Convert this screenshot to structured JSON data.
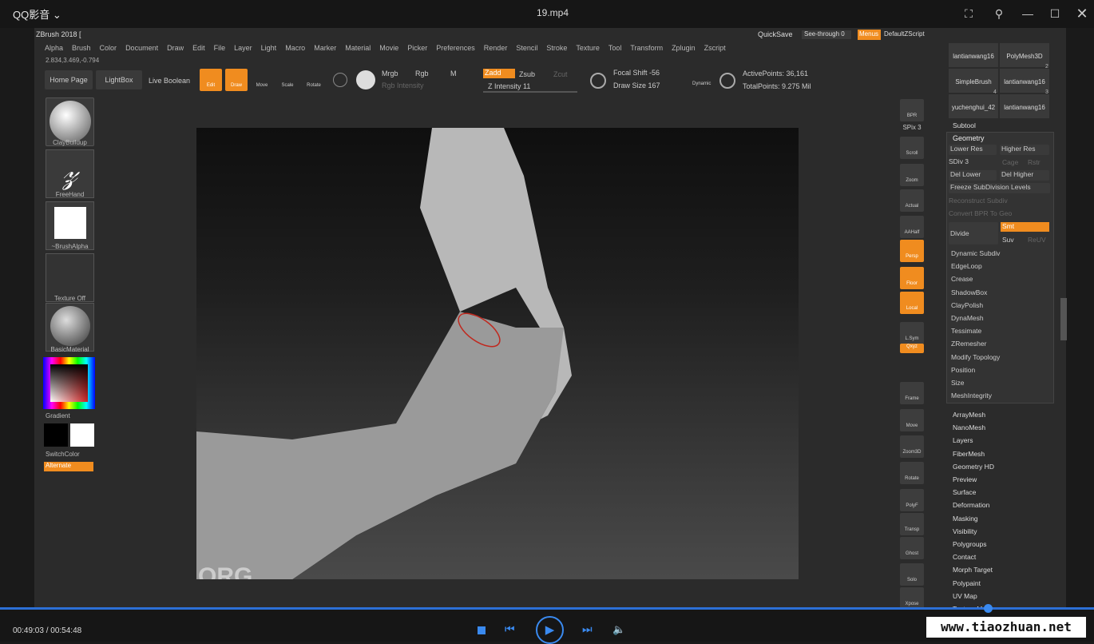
{
  "player": {
    "brand": "QQ影音",
    "title": "19.mp4",
    "time": "00:49:03 / 00:54:48",
    "watermark": "www.tiaozhuan.net"
  },
  "zbrush": {
    "title": "ZBrush 2018 [",
    "coords": "2.834,3.469,-0.794",
    "menus": [
      "Alpha",
      "Brush",
      "Color",
      "Document",
      "Draw",
      "Edit",
      "File",
      "Layer",
      "Light",
      "Macro",
      "Marker",
      "Material",
      "Movie",
      "Picker",
      "Preferences",
      "Render",
      "Stencil",
      "Stroke",
      "Texture",
      "Tool",
      "Transform",
      "Zplugin",
      "Zscript"
    ],
    "quicksave": "QuickSave",
    "seethrough": "See-through  0",
    "menus_btn": "Menus",
    "defaultzscript": "DefaultZScript",
    "toolbar": {
      "home": "Home Page",
      "lightbox": "LightBox",
      "live_boolean": "Live Boolean",
      "edit": "Edit",
      "draw": "Draw",
      "move": "Move",
      "scale": "Scale",
      "rotate": "Rotate",
      "mrgb": "Mrgb",
      "rgb": "Rgb",
      "m": "M",
      "zadd": "Zadd",
      "zsub": "Zsub",
      "zcut": "Zcut",
      "rgb_intensity": "Rgb Intensity",
      "z_intensity": "Z Intensity 11",
      "focal_shift": "Focal Shift -56",
      "draw_size": "Draw Size 167",
      "dynamic": "Dynamic",
      "active_points": "ActivePoints: 36,161",
      "total_points": "TotalPoints: 9.275 Mil"
    },
    "left": {
      "claybuildup": "ClayBuildup",
      "freehand": "FreeHand",
      "brushalpha": "~BrushAlpha",
      "texture_off": "Texture Off",
      "basic_material": "BasicMaterial",
      "gradient": "Gradient",
      "switchcolor": "SwitchColor",
      "alternate": "Alternate"
    },
    "canvas_label": "ORG",
    "right_tools": [
      "BPR",
      "SPix 3",
      "Scroll",
      "Zoom",
      "Actual",
      "AAHalf",
      "Persp",
      "Floor",
      "Local",
      "L.Sym",
      "Qxyz",
      "Frame",
      "Move",
      "Zoom3D",
      "Rotate",
      "PolyF",
      "Transp",
      "Ghost",
      "Solo",
      "Xpose"
    ],
    "subtool_thumbs": [
      "lantianwang16",
      "PolyMesh3D",
      "SimpleBrush",
      "lantianwang16",
      "yuchenghui_42",
      "lantianwang16"
    ],
    "subtool_counts": [
      "2",
      "4",
      "3"
    ],
    "subtool": "Subtool",
    "geometry": {
      "header": "Geometry",
      "lower_res": "Lower Res",
      "higher_res": "Higher Res",
      "sdiv": "SDiv 3",
      "cage": "Cage",
      "rstr": "Rstr",
      "del_lower": "Del Lower",
      "del_higher": "Del Higher",
      "freeze": "Freeze SubDivision Levels",
      "reconstruct": "Reconstruct Subdiv",
      "convert": "Convert BPR To Geo",
      "divide": "Divide",
      "smt": "Smt",
      "suv": "Suv",
      "reuv": "ReUV",
      "items": [
        "Dynamic Subdiv",
        "EdgeLoop",
        "Crease",
        "ShadowBox",
        "ClayPolish",
        "DynaMesh",
        "Tessimate",
        "ZRemesher",
        "Modify Topology",
        "Position",
        "Size",
        "MeshIntegrity"
      ]
    },
    "tool_list": [
      "ArrayMesh",
      "NanoMesh",
      "Layers",
      "FiberMesh",
      "Geometry HD",
      "Preview",
      "Surface",
      "Deformation",
      "Masking",
      "Visibility",
      "Polygroups",
      "Contact",
      "Morph Target",
      "Polypaint",
      "UV Map",
      "Texture Map"
    ]
  }
}
